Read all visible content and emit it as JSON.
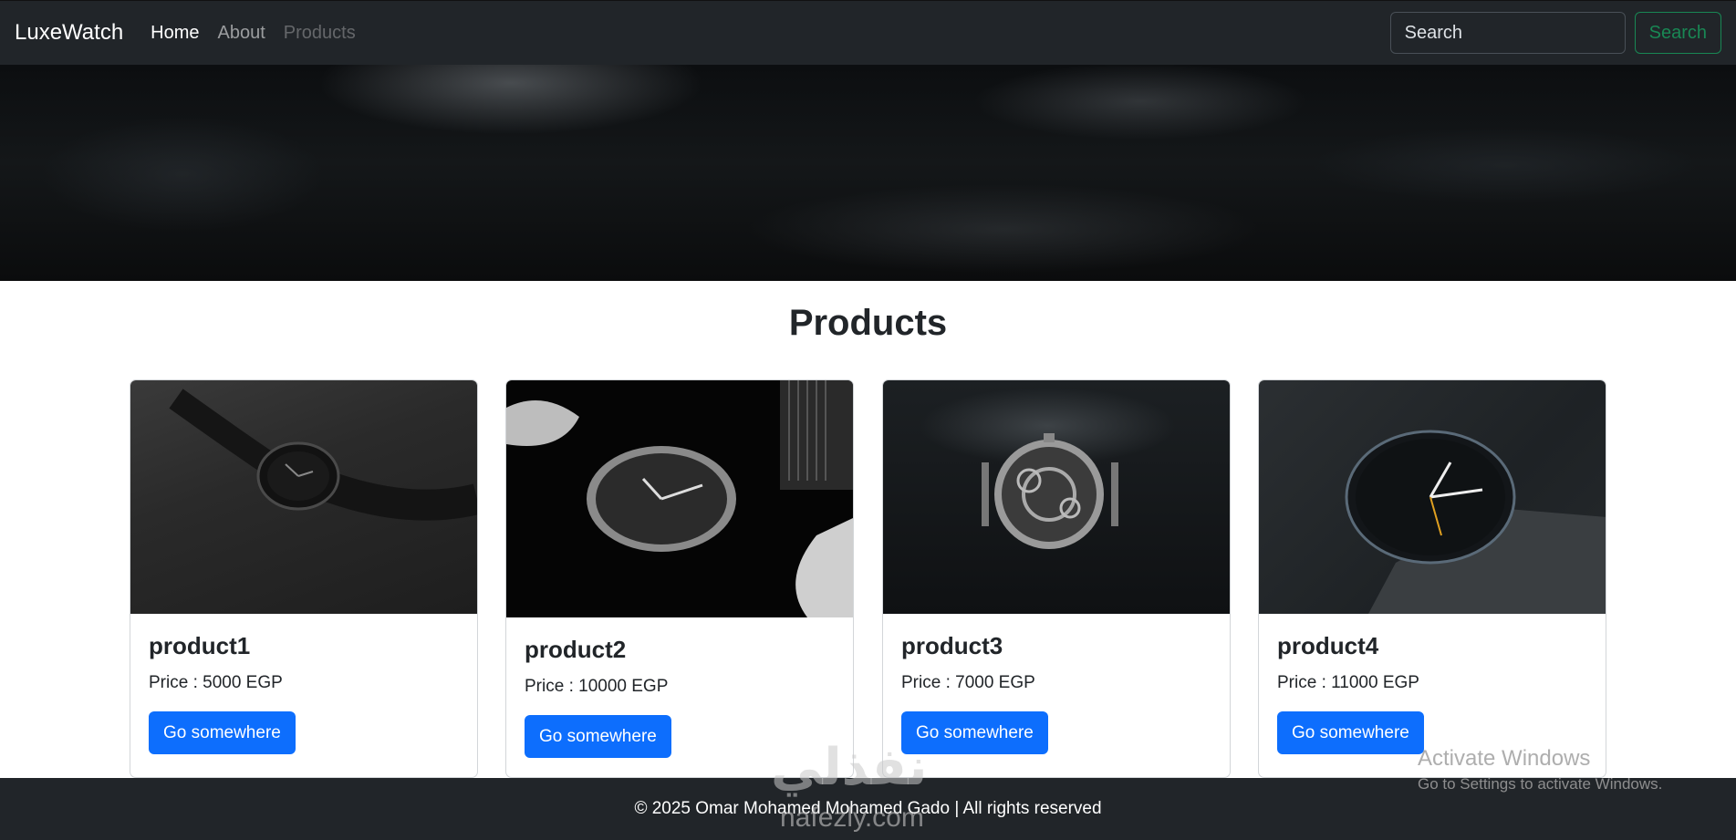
{
  "navbar": {
    "brand": "LuxeWatch",
    "links": [
      "Home",
      "About",
      "Products"
    ],
    "search_placeholder": "Search",
    "search_button": "Search"
  },
  "products_section": {
    "title": "Products",
    "cards": [
      {
        "name": "product1",
        "price": "Price : 5000 EGP",
        "button": "Go somewhere",
        "image_icon": "watch-image"
      },
      {
        "name": "product2",
        "price": "Price : 10000 EGP",
        "button": "Go somewhere",
        "image_icon": "watch-image"
      },
      {
        "name": "product3",
        "price": "Price : 7000 EGP",
        "button": "Go somewhere",
        "image_icon": "watch-image"
      },
      {
        "name": "product4",
        "price": "Price : 11000 EGP",
        "button": "Go somewhere",
        "image_icon": "watch-image"
      }
    ]
  },
  "footer": {
    "text": "© 2025 Omar Mohamed Mohamed Gado | All rights reserved"
  },
  "overlays": {
    "watermark_logo": "نفذلي",
    "watermark_site": "nafezly.com",
    "activate_title": "Activate Windows",
    "activate_sub": "Go to Settings to activate Windows."
  },
  "colors": {
    "navbar_bg": "#212529",
    "primary": "#0d6efd",
    "success": "#198754"
  }
}
